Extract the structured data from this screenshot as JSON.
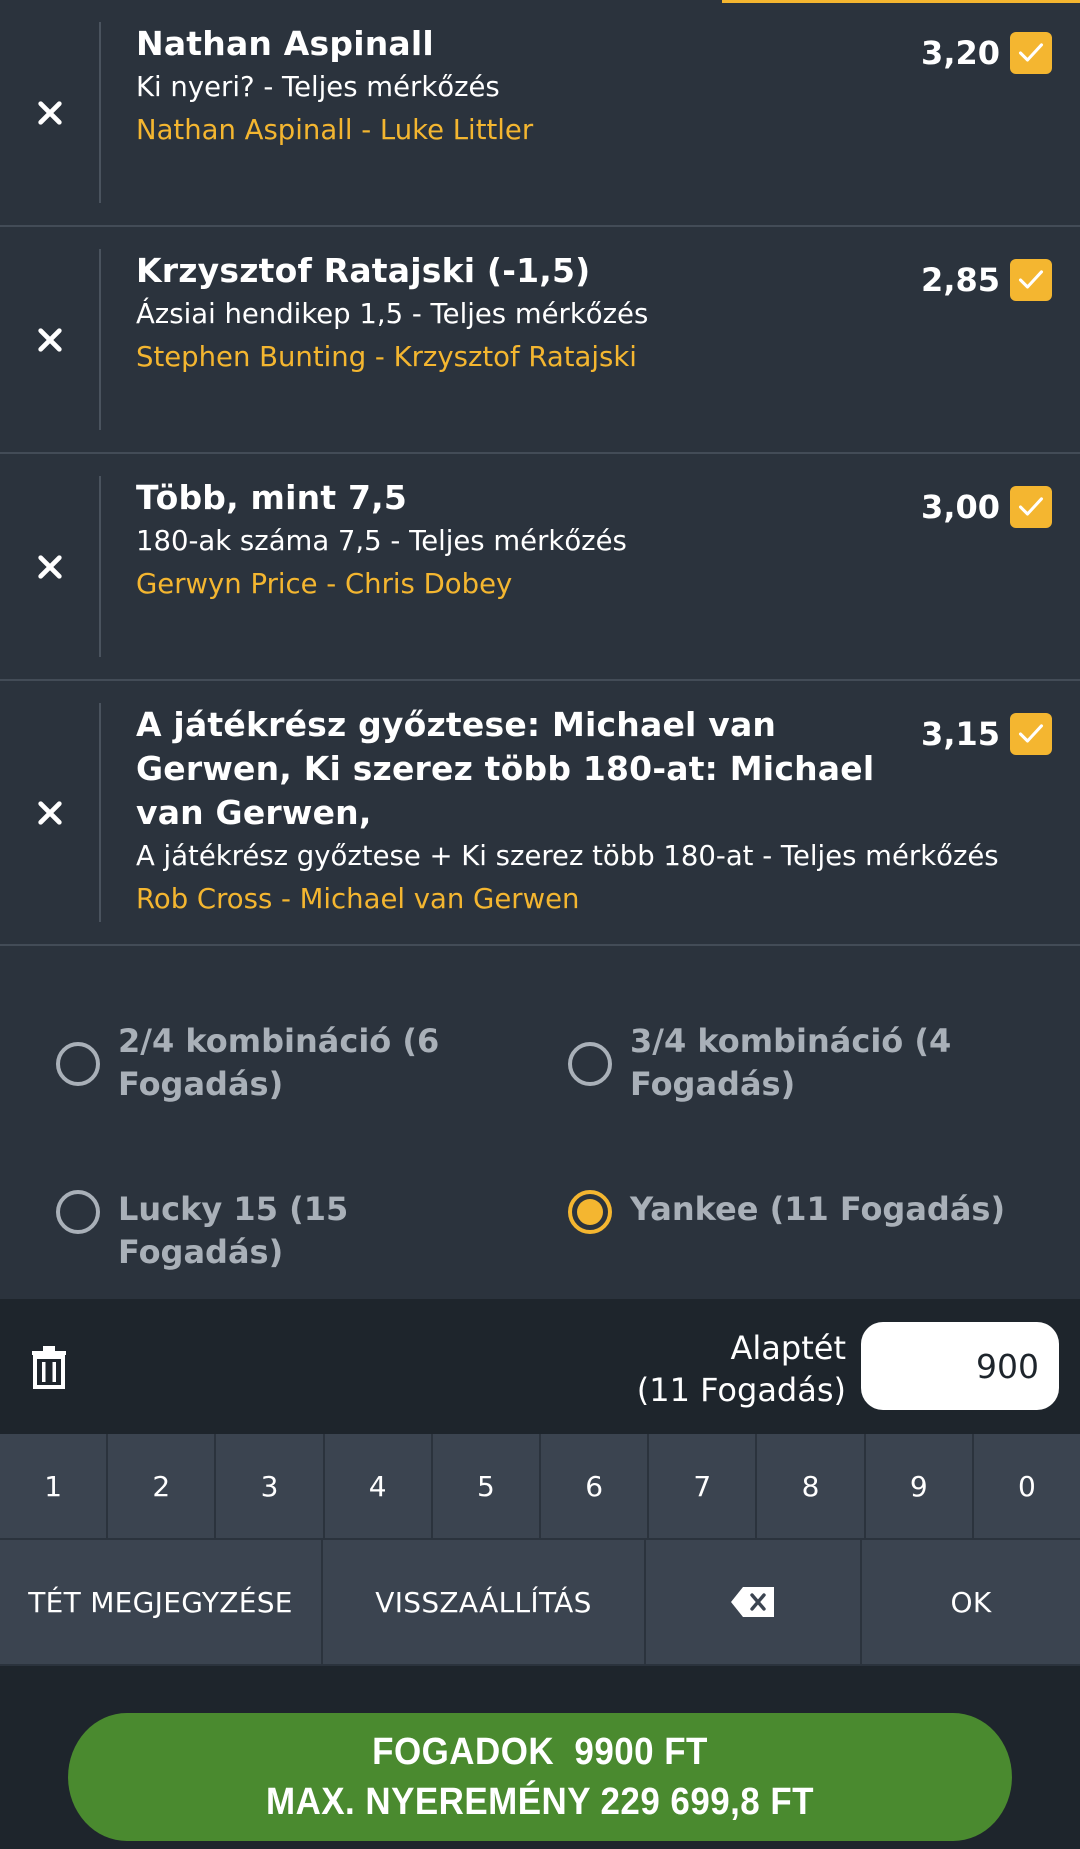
{
  "bets": [
    {
      "title": "Nathan Aspinall",
      "market": "Ki nyeri? - Teljes mérkőzés",
      "event": "Nathan Aspinall - Luke Littler",
      "odds": "3,20"
    },
    {
      "title": "Krzysztof Ratajski (-1,5)",
      "market": "Ázsiai hendikep 1,5 - Teljes mérkőzés",
      "event": "Stephen Bunting - Krzysztof Ratajski",
      "odds": "2,85"
    },
    {
      "title": "Több, mint 7,5",
      "market": "180-ak száma 7,5 - Teljes mérkőzés",
      "event": "Gerwyn Price - Chris Dobey",
      "odds": "3,00"
    },
    {
      "title": "A játékrész győztese: Michael van Gerwen, Ki szerez több 180-at: Michael van Gerwen,",
      "market": "A játékrész győztese + Ki szerez több 180-at - Teljes mérkőzés",
      "event": "Rob Cross - Michael van Gerwen",
      "odds": "3,15"
    }
  ],
  "systems": {
    "opt1": "2/4 kombináció (6 Fogadás)",
    "opt2": "3/4 kombináció (4 Fogadás)",
    "opt3": "Lucky 15 (15 Fogadás)",
    "opt4": "Yankee (11 Fogadás)",
    "selected": "opt4"
  },
  "stake": {
    "label_line1": "Alaptét",
    "label_line2": "(11 Fogadás)",
    "value": "900"
  },
  "keypad": {
    "digits": [
      "1",
      "2",
      "3",
      "4",
      "5",
      "6",
      "7",
      "8",
      "9",
      "0"
    ],
    "remember": "TÉT MEGJEGYZÉSE",
    "reset": "VISSZAÁLLÍTÁS",
    "ok": "OK"
  },
  "place_bet": {
    "line1": "FOGADOK  9900 FT",
    "line2": "MAX. NYEREMÉNY 229 699,8 FT"
  },
  "colors": {
    "accent": "#f4b630",
    "background": "#2b333d",
    "dark": "#1e252c",
    "key": "#3b4450",
    "place_button": "#4a8a2f"
  }
}
